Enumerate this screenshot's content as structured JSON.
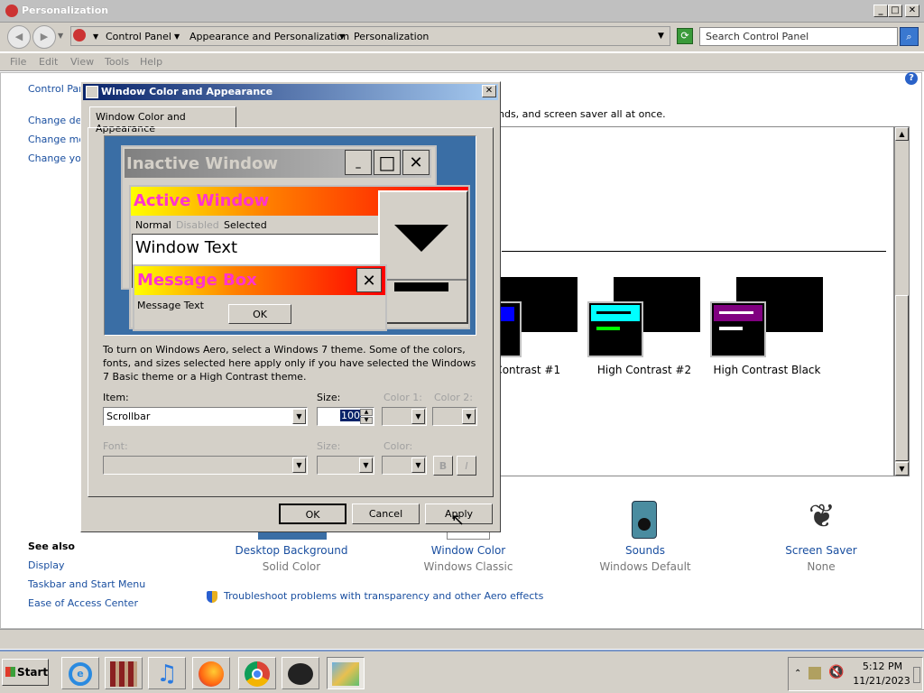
{
  "window": {
    "title": "Personalization",
    "min": "_",
    "max": "□",
    "close": "✕"
  },
  "address": {
    "segments": [
      "Control Panel",
      "Appearance and Personalization",
      "Personalization"
    ],
    "search_placeholder": "Search Control Panel"
  },
  "menu": [
    "File",
    "Edit",
    "View",
    "Tools",
    "Help"
  ],
  "left": {
    "home": "Control Pan",
    "links": [
      "Change des",
      "Change mou",
      "Change you"
    ],
    "see_also_heading": "See also",
    "see_also": [
      "Display",
      "Taskbar and Start Menu",
      "Ease of Access Center"
    ]
  },
  "main": {
    "intro_fragment": "nds, and screen saver all at once.",
    "themes": [
      "h Contrast #1",
      "High Contrast #2",
      "High Contrast Black"
    ],
    "bottom": [
      {
        "label": "Desktop Background",
        "sub": "Solid Color"
      },
      {
        "label": "Window Color",
        "sub": "Windows Classic"
      },
      {
        "label": "Sounds",
        "sub": "Windows Default"
      },
      {
        "label": "Screen Saver",
        "sub": "None"
      }
    ],
    "troubleshoot": "Troubleshoot problems with transparency and other Aero effects"
  },
  "dialog": {
    "title": "Window Color and Appearance",
    "tab": "Window Color and Appearance",
    "preview": {
      "inactive": "Inactive Window",
      "active": "Active Window",
      "normal": "Normal",
      "disabled": "Disabled",
      "selected": "Selected",
      "window_text": "Window Text",
      "message_box": "Message Box",
      "message_text": "Message Text",
      "ok": "OK"
    },
    "info": "To turn on Windows Aero, select a Windows 7 theme.  Some of the colors, fonts, and sizes selected here apply only if you have selected the Windows 7 Basic theme or a High Contrast theme.",
    "item_label": "Item:",
    "item_value": "Scrollbar",
    "size_label": "Size:",
    "size_value": "100",
    "color1_label": "Color 1:",
    "color2_label": "Color 2:",
    "font_label": "Font:",
    "font_size_label": "Size:",
    "font_color_label": "Color:",
    "bold": "B",
    "italic": "I",
    "ok": "OK",
    "cancel": "Cancel",
    "apply": "Apply"
  },
  "taskbar": {
    "start": "Start",
    "time": "5:12 PM",
    "date": "11/21/2023"
  },
  "colors": {
    "active_grad_start": "#ffff00",
    "active_grad_end": "#ff0000",
    "magenta": "#ff33cc",
    "desktop": "#3a6ea5"
  }
}
